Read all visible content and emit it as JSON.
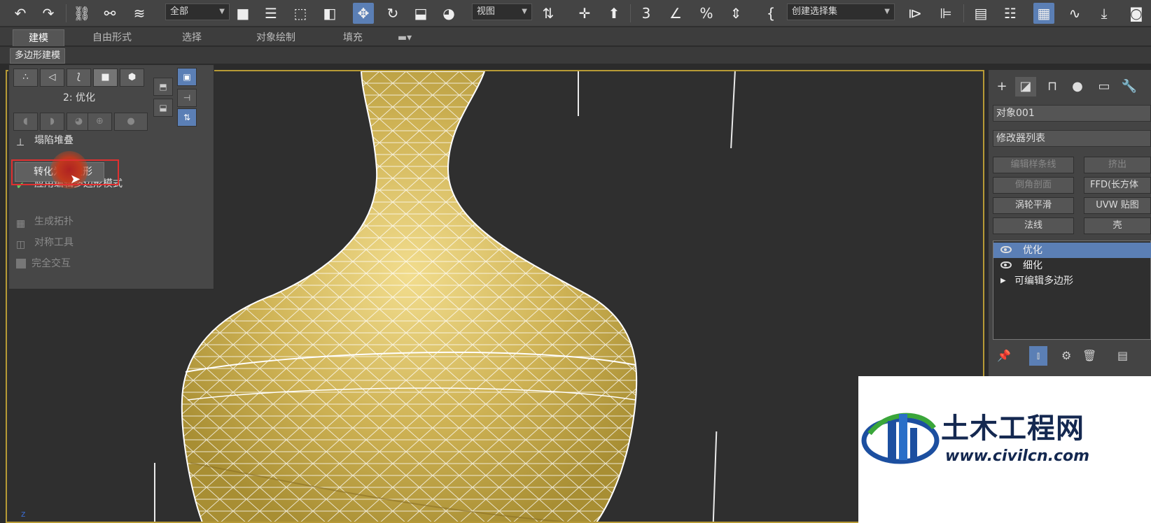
{
  "toolbar": {
    "selection_filter": "全部",
    "reference_coord": "视图",
    "named_selection": "创建选择集"
  },
  "ribbon": {
    "tabs": [
      "建模",
      "自由形式",
      "选择",
      "对象绘制",
      "填充"
    ],
    "active_tab": "建模",
    "sub_tab": "多边形建模"
  },
  "polygon_panel": {
    "level_label": "2: 优化",
    "items": {
      "collapse": "塌陷堆叠",
      "convert": "转换为多边形",
      "convert_visible": "转化为多边形",
      "apply_mode": "应用编辑多边形模式",
      "generate_topo": "生成拓扑",
      "symmetry": "对称工具",
      "full_interactive": "完全交互"
    }
  },
  "command_panel": {
    "object_name": "对象001",
    "modifier_list": "修改器列表",
    "modifier_buttons": [
      {
        "label": "编辑样条线",
        "enabled": false
      },
      {
        "label": "挤出",
        "enabled": false
      },
      {
        "label": "倒角剖面",
        "enabled": false
      },
      {
        "label": "FFD(长方体",
        "enabled": true
      },
      {
        "label": "涡轮平滑",
        "enabled": true
      },
      {
        "label": "UVW 贴图",
        "enabled": true
      },
      {
        "label": "法线",
        "enabled": true
      },
      {
        "label": "壳",
        "enabled": true
      }
    ],
    "stack": [
      {
        "label": "优化",
        "selected": true,
        "visible_eye": true
      },
      {
        "label": "细化",
        "selected": false,
        "visible_eye": true
      },
      {
        "label": "可编辑多边形",
        "selected": false,
        "visible_eye": false
      }
    ]
  },
  "watermark": {
    "title": "土木工程网",
    "url": "www.civilcn.com"
  },
  "colors": {
    "accent_blue": "#5b7fb5",
    "viewport_border": "#b79a36",
    "vase_yellow": "#c9ae4c",
    "highlight_red": "#e03030"
  }
}
